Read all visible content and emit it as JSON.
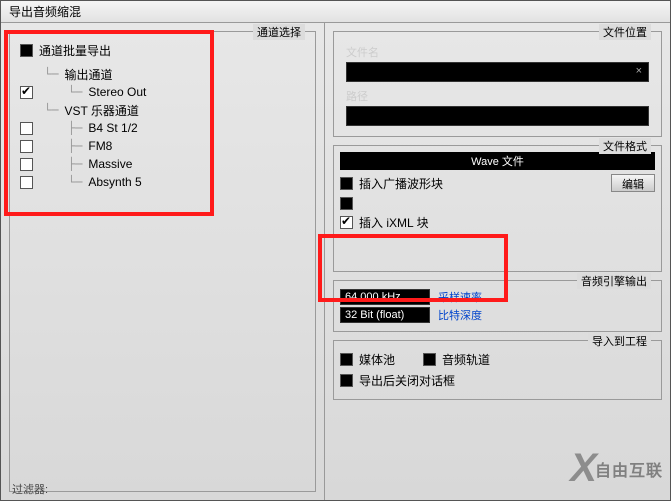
{
  "window": {
    "title": "导出音频缩混"
  },
  "left": {
    "legend": "通道选择",
    "batch_label": "通道批量导出",
    "tree": {
      "output_channel": "输出通道",
      "stereo_out": "Stereo Out",
      "vst_channel": "VST 乐器通道",
      "b4": "B4 St 1/2",
      "fm8": "FM8",
      "massive": "Massive",
      "absynth": "Absynth 5"
    },
    "filter": "过滤器:"
  },
  "file_location": {
    "legend": "文件位置",
    "filename_label": "文件名",
    "path_label": "路径"
  },
  "file_format": {
    "legend": "文件格式",
    "format_value": "Wave 文件",
    "insert_broadcast": "插入广播波形块",
    "edit": "编辑",
    "insert_ixml": "插入 iXML 块"
  },
  "engine": {
    "legend": "音频引擎输出",
    "sample_rate_value": "64.000 kHz",
    "sample_rate_label": "采样速率",
    "bit_depth_value": "32 Bit (float)",
    "bit_depth_label": "比特深度"
  },
  "import": {
    "legend": "导入到工程",
    "mediapool": "媒体池",
    "audio_track": "音频轨道",
    "close_after": "导出后关闭对话框"
  },
  "watermark": "自由互联"
}
